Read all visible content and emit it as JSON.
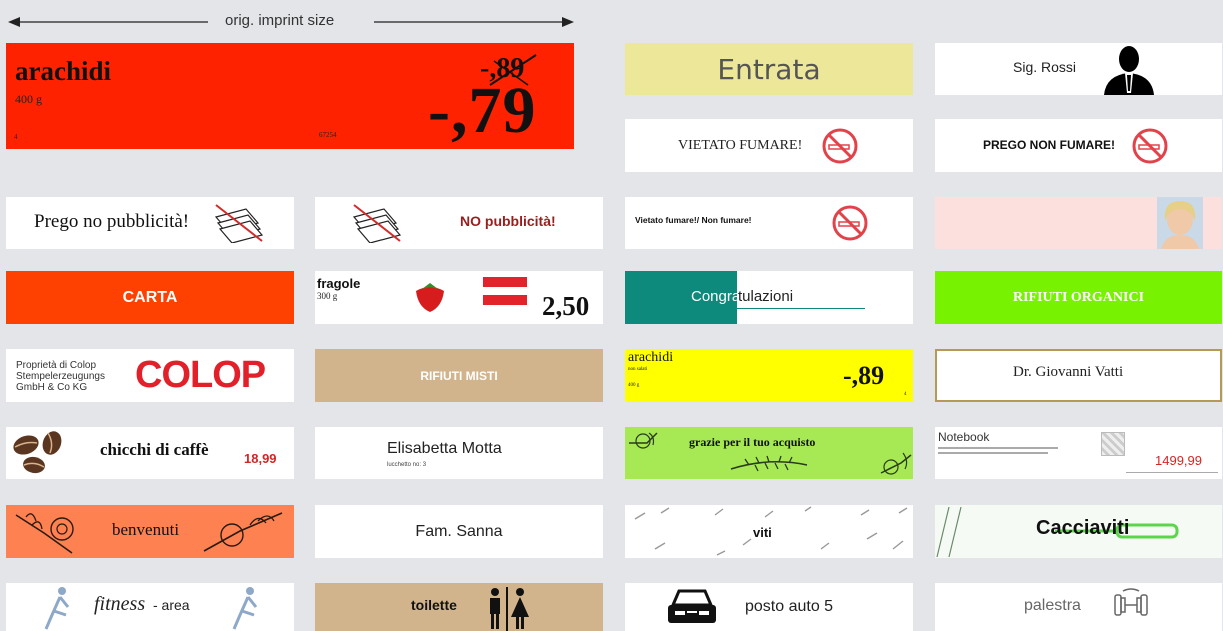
{
  "header": {
    "imprint_label": "orig. imprint size"
  },
  "colors": {
    "bg": "#e3e5e8",
    "red": "#ff2200",
    "orange_red": "#fe4100",
    "yellow_soft": "#ede79a",
    "teal": "#0d8a7c",
    "lime": "#77f200",
    "tan": "#d2b48c",
    "yellow": "#ffff00",
    "salmon": "#fe8152",
    "green_soft": "#a6e955",
    "gold": "#b49a55"
  },
  "labels": {
    "arachidi_big": {
      "name": "arachidi",
      "weight": "400 g",
      "old_price": "-,89",
      "price": "-,79",
      "num": "4",
      "code": "67254"
    },
    "entrata": {
      "text": "Entrata"
    },
    "sig_rossi": {
      "text": "Sig. Rossi",
      "icon": "businessman-icon"
    },
    "vietato_fumare": {
      "text": "VIETATO FUMARE!",
      "icon": "no-smoking-icon"
    },
    "prego_non_fumare": {
      "text": "PREGO NON FUMARE!",
      "icon": "no-smoking-icon"
    },
    "prego_no_pubblicita": {
      "text": "Prego no pubblicità!",
      "icon": "no-newspapers-icon"
    },
    "no_pubblicita": {
      "text": "NO pubblicità!",
      "icon": "no-newspapers-icon"
    },
    "vietato_non_fumare": {
      "text": "Vietato fumare!/ Non fumare!",
      "icon": "no-smoking-icon"
    },
    "woman_photo": {
      "icon": "woman-portrait-icon"
    },
    "carta": {
      "text": "CARTA"
    },
    "fragole": {
      "name": "fragole",
      "weight": "300 g",
      "price": "2,50",
      "icon": "strawberry-icon"
    },
    "congratulazioni": {
      "text_a": "Congra",
      "text_b": "tulazioni"
    },
    "rifiuti_organici": {
      "text": "RIFIUTI ORGANICI"
    },
    "colop": {
      "text": "Proprietà di Colop Stempelerzeugungs GmbH & Co KG",
      "logo": "COLOP"
    },
    "rifiuti_misti": {
      "text": "RIFIUTI MISTI"
    },
    "arachidi_small": {
      "name": "arachidi",
      "sub": "non salati",
      "weight": "400 g",
      "price": "-,89",
      "num": "4"
    },
    "dr_vatti": {
      "text": "Dr. Giovanni Vatti"
    },
    "chicchi": {
      "text": "chicchi di caffè",
      "price": "18,99",
      "icon": "coffee-beans-icon"
    },
    "elisabetta": {
      "text": "Elisabetta Motta",
      "sub": "lucchetto no: 3"
    },
    "grazie": {
      "text": "grazie per il tuo acquisto",
      "icon": "flower-icon"
    },
    "notebook": {
      "title": "Notebook",
      "price": "1499,99"
    },
    "benvenuti": {
      "text": "benvenuti",
      "icon": "flower-icon"
    },
    "fam_sanna": {
      "text": "Fam. Sanna"
    },
    "viti": {
      "text": "viti",
      "icon": "screw-icon"
    },
    "cacciaviti": {
      "text": "Cacciaviti",
      "icon": "screwdriver-icon"
    },
    "fitness": {
      "text_a": "fitness",
      "text_b": "- area",
      "icon": "athlete-icon"
    },
    "toilette": {
      "text": "toilette",
      "icon": "toilet-icon"
    },
    "posto_auto": {
      "text": "posto auto 5",
      "icon": "car-icon"
    },
    "palestra": {
      "text": "palestra",
      "icon": "dumbbell-icon"
    }
  }
}
